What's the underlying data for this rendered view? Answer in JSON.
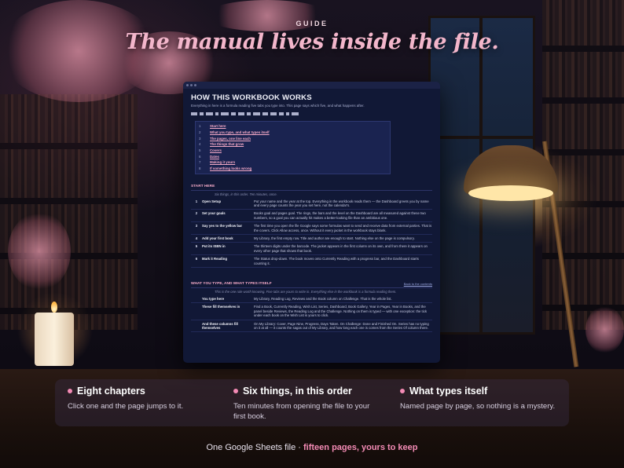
{
  "header": {
    "eyebrow": "GUIDE",
    "headline": "The manual lives inside the file."
  },
  "doc": {
    "title": "HOW THIS WORKBOOK WORKS",
    "subtitle": "Everything in here is a formula reading five tabs you type into. This page says which five, and what happens after.",
    "toc": [
      {
        "num": "1",
        "label": "Start here"
      },
      {
        "num": "2",
        "label": "What you type, and what types itself"
      },
      {
        "num": "3",
        "label": "The pages, one line each"
      },
      {
        "num": "4",
        "label": "The things that grow"
      },
      {
        "num": "5",
        "label": "Covers"
      },
      {
        "num": "6",
        "label": "Dates"
      },
      {
        "num": "7",
        "label": "Making it yours"
      },
      {
        "num": "8",
        "label": "If something looks wrong"
      }
    ],
    "start": {
      "heading": "START HERE",
      "note": "Six things, in this order. Ten minutes, once.",
      "rows": [
        {
          "n": "1",
          "k": "Open Setup",
          "v": "Put your name and the year at the top. Everything in the workbook reads them — the Dashboard greets you by name and every page counts the year you set here, not the calendar's."
        },
        {
          "n": "2",
          "k": "Set your goals",
          "v": "Books goal and pages goal. The rings, the bars and the level on the Dashboard are all measured against these two numbers, so a goal you can actually hit makes a better-looking file than an ambitious one."
        },
        {
          "n": "3",
          "k": "Say yes to the yellow bar",
          "v": "The first time you open the file Google says some formulas want to send and receive data from external parties. That is the covers. Click Allow access, once. Without it every jacket in the workbook stays blank."
        },
        {
          "n": "4",
          "k": "Add your first book",
          "v": "My Library, the first empty row. Title and author are enough to start. Nothing else on the page is compulsory."
        },
        {
          "n": "5",
          "k": "Put its ISBN in",
          "v": "The thirteen digits under the barcode. The jacket appears in the first column on its own, and from there it appears on every other page that shows that book."
        },
        {
          "n": "6",
          "k": "Mark it Reading",
          "v": "The Status drop-down. The book moves onto Currently Reading with a progress bar, and the Dashboard starts counting it."
        }
      ]
    },
    "types": {
      "heading": "WHAT YOU TYPE, AND WHAT TYPES ITSELF",
      "back": "Back to the contents",
      "note": "This is the one rule worth knowing. Five tabs are yours to write in. Everything else in the workbook is a formula reading them.",
      "rows": [
        {
          "n": "",
          "k": "You type here",
          "v": "My Library, Reading Log, Reviews and the Book column on Challenge. That is the whole list."
        },
        {
          "n": "",
          "k": "These fill themselves in",
          "v": "Find a Book, Currently Reading, Wish List, Series, Dashboard, Book Gallery, Year in Pages, Year in Books, and the panel beside Reviews, the Reading Log and the Challenge. Nothing on them is typed — with one exception: the tick under each book on the Wish List is yours to click."
        },
        {
          "n": "",
          "k": "And these columns fill themselves",
          "v": "On My Library: Cover, Page Nine, Progress, Days Taken. On Challenge: Done and Finished On. Series has no typing on it at all — it counts the sagas out of My Library, and how long each one is comes from the Series Of column there."
        }
      ]
    }
  },
  "features": [
    {
      "title": "Eight chapters",
      "desc": "Click one and the page jumps to it."
    },
    {
      "title": "Six things, in this order",
      "desc": "Ten minutes from opening the file to your first book."
    },
    {
      "title": "What types itself",
      "desc": "Named page by page, so nothing is a mystery."
    }
  ],
  "footer": {
    "lead": "One Google Sheets file · ",
    "accent": "fifteen pages, yours to keep"
  },
  "colors": {
    "accent": "#f48bb5",
    "headline": "#f3b6cb",
    "doc_bg": "#111836"
  }
}
